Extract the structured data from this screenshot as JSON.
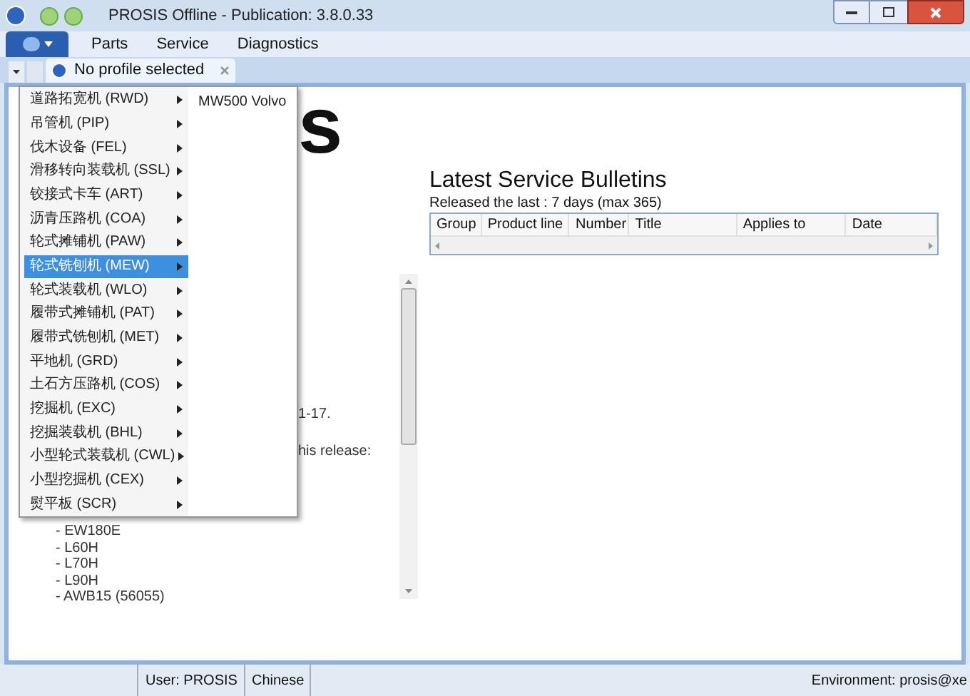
{
  "window": {
    "title": "PROSIS Offline - Publication: 3.8.0.33"
  },
  "menu_bar": [
    "Parts",
    "Service",
    "Diagnostics"
  ],
  "tabs": [
    {
      "label": "No profile selected",
      "selected": true
    }
  ],
  "background": {
    "heading_fragment": "s",
    "line_1": "1-17.",
    "line_2": "his release:",
    "models": [
      "- EW180E",
      "- L60H",
      "- L70H",
      "- L90H",
      "- AWB15 (56055)"
    ]
  },
  "bulletins": {
    "title": "Latest Service Bulletins",
    "subtitle": "Released the last : 7 days (max 365)",
    "columns": [
      "Group",
      "Product line",
      "Number",
      "Title",
      "Applies to",
      "Date"
    ]
  },
  "popup_menu": {
    "items": [
      {
        "label": "道路拓宽机 (RWD)",
        "selected": false
      },
      {
        "label": "吊管机 (PIP)",
        "selected": false
      },
      {
        "label": "伐木设备 (FEL)",
        "selected": false
      },
      {
        "label": "滑移转向装载机 (SSL)",
        "selected": false
      },
      {
        "label": "铰接式卡车 (ART)",
        "selected": false
      },
      {
        "label": "沥青压路机 (COA)",
        "selected": false
      },
      {
        "label": "轮式摊铺机 (PAW)",
        "selected": false
      },
      {
        "label": "轮式铣刨机 (MEW)",
        "selected": true
      },
      {
        "label": "轮式装载机 (WLO)",
        "selected": false
      },
      {
        "label": "履带式摊铺机 (PAT)",
        "selected": false
      },
      {
        "label": "履带式铣刨机 (MET)",
        "selected": false
      },
      {
        "label": "平地机 (GRD)",
        "selected": false
      },
      {
        "label": "土石方压路机 (COS)",
        "selected": false
      },
      {
        "label": "挖掘机 (EXC)",
        "selected": false
      },
      {
        "label": "挖掘装载机 (BHL)",
        "selected": false
      },
      {
        "label": "小型轮式装载机 (CWL)",
        "selected": false
      },
      {
        "label": "小型挖掘机 (CEX)",
        "selected": false
      },
      {
        "label": "熨平板 (SCR)",
        "selected": false
      }
    ],
    "submenu": [
      "MW500 Volvo"
    ]
  },
  "status_bar": {
    "user": "User: PROSIS",
    "language": "Chinese",
    "environment": "Environment: prosis@xe"
  }
}
